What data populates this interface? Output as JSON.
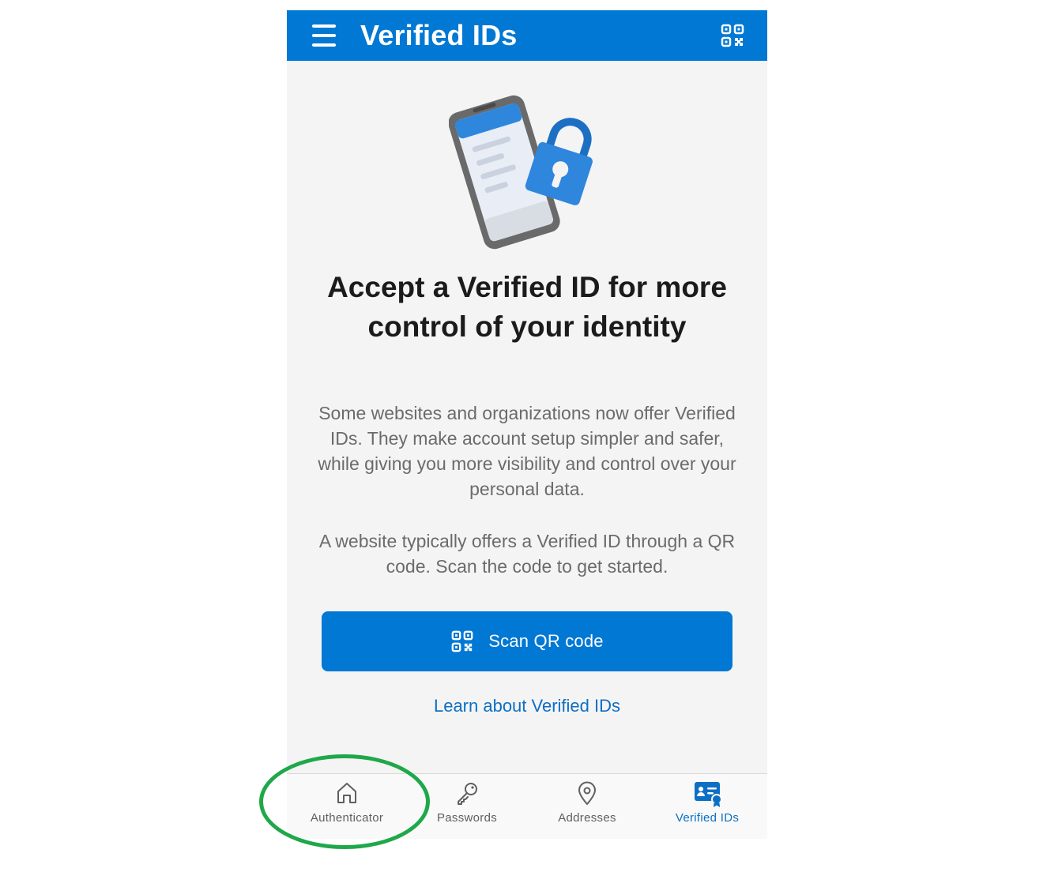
{
  "header": {
    "title": "Verified IDs",
    "menu_icon": "hamburger-menu-icon",
    "qr_icon": "qr-code-icon"
  },
  "main": {
    "illustration": "phone-with-padlock-illustration",
    "headline": "Accept a Verified ID for more control of your identity",
    "paragraph1": "Some websites and organizations now offer Verified IDs. They make account setup simpler and safer, while giving you more visibility and control over your personal data.",
    "paragraph2": "A website typically offers a Verified ID through a QR code. Scan the code to get started.",
    "scan_button_label": "Scan QR code",
    "learn_link": "Learn about Verified IDs"
  },
  "tabs": [
    {
      "label": "Authenticator",
      "icon": "home-icon",
      "active": false
    },
    {
      "label": "Passwords",
      "icon": "key-icon",
      "active": false
    },
    {
      "label": "Addresses",
      "icon": "location-pin-icon",
      "active": false
    },
    {
      "label": "Verified IDs",
      "icon": "verified-id-card-icon",
      "active": true
    }
  ],
  "colors": {
    "brand_blue": "#0078d4",
    "link_blue": "#0c6fc4",
    "highlight_green": "#1fa84a"
  }
}
